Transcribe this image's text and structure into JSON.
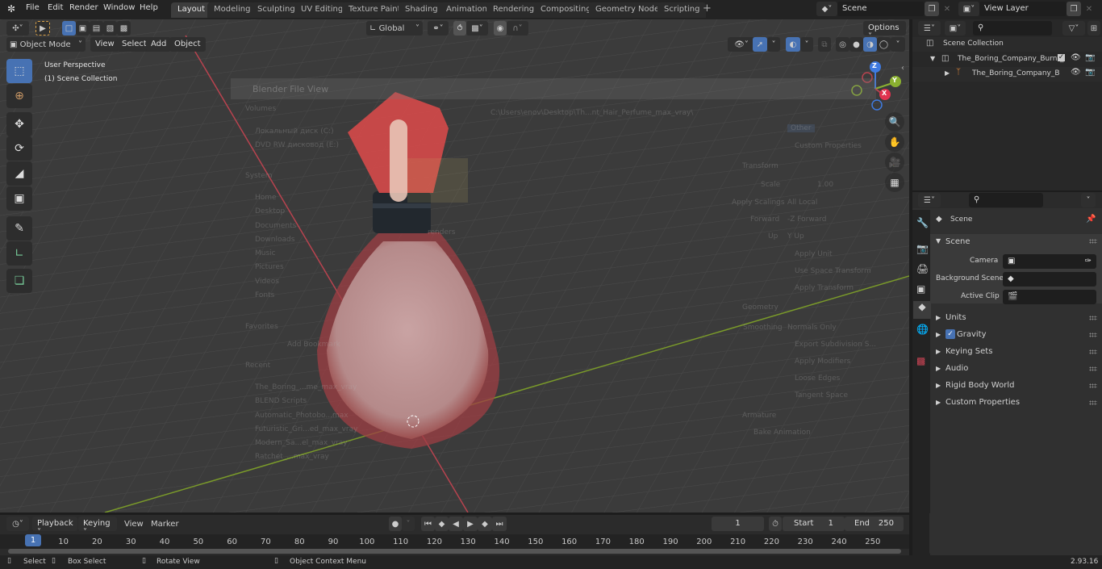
{
  "topbar": {
    "menu": [
      "File",
      "Edit",
      "Render",
      "Window",
      "Help"
    ],
    "workspaces": [
      "Layout",
      "Modeling",
      "Sculpting",
      "UV Editing",
      "Texture Paint",
      "Shading",
      "Animation",
      "Rendering",
      "Compositing",
      "Geometry Nodes",
      "Scripting"
    ],
    "active_workspace": "Layout",
    "add_workspace": "+",
    "scene": "Scene",
    "view_layer": "View Layer"
  },
  "viewport": {
    "mode": "Object Mode",
    "menus": [
      "View",
      "Select",
      "Add",
      "Object"
    ],
    "transform_orientation": "Global",
    "options": "Options",
    "overlay_title": "User Perspective",
    "overlay_collection": "(1) Scene Collection",
    "gizmo": {
      "z": "Z",
      "y": "Y",
      "x": "X"
    },
    "tools": [
      "select-box",
      "cursor",
      "move",
      "rotate",
      "scale",
      "transform",
      "annotate",
      "measure",
      "add-cube"
    ]
  },
  "file_view_ghost": {
    "title": "Blender File View",
    "path": "C:\\Users\\enov\\Desktop\\Th...nt_Hair_Perfume_max_vray\\",
    "volumes_header": "Volumes",
    "volumes": [
      "Локальный диск (C:)",
      "DVD RW дисковод (E:)"
    ],
    "system_header": "System",
    "system": [
      "Home",
      "Desktop",
      "Documents",
      "Downloads",
      "Music",
      "Pictures",
      "Videos",
      "Fonts"
    ],
    "favorites_header": "Favorites",
    "add_bookmark": "Add Bookmark",
    "recent_header": "Recent",
    "recent": [
      "The_Boring_...me_max_vray",
      "BLEND Scripts",
      "Automatic_Photobo...max",
      "Futuristic_Gri...ed_max_vray",
      "Modern_Sa...el_max_vray",
      "Ratchet_...max_vray"
    ],
    "folder_label": "renders",
    "options": {
      "other": "Other",
      "custom_properties": "Custom Properties",
      "transform_header": "Transform",
      "scale_label": "Scale",
      "scale": "1.00",
      "apply_scalings_label": "Apply Scalings",
      "apply_scalings": "All Local",
      "forward_label": "Forward",
      "forward": "-Z Forward",
      "up_label": "Up",
      "up": "Y Up",
      "apply_unit": "Apply Unit",
      "use_space_transform": "Use Space Transform",
      "apply_transform": "Apply Transform",
      "geometry_header": "Geometry",
      "smoothing_label": "Smoothing",
      "smoothing": "Normals Only",
      "export_subdivision": "Export Subdivision S...",
      "apply_modifiers": "Apply Modifiers",
      "loose_edges": "Loose Edges",
      "tangent_space": "Tangent Space",
      "armature_header": "Armature",
      "bake_animation": "Bake Animation"
    }
  },
  "outliner": {
    "root": "Scene Collection",
    "items": [
      {
        "label": "The_Boring_Company_Burnt_",
        "type": "collection"
      },
      {
        "label": "The_Boring_Company_B",
        "type": "empty"
      }
    ]
  },
  "properties": {
    "context": "Scene",
    "panel": "Scene",
    "camera_label": "Camera",
    "background_scene_label": "Background Scene",
    "active_clip_label": "Active Clip",
    "sections": [
      "Units",
      "Gravity",
      "Keying Sets",
      "Audio",
      "Rigid Body World",
      "Custom Properties"
    ],
    "gravity_checked": true
  },
  "timeline": {
    "menus": [
      "Playback",
      "Keying",
      "View",
      "Marker"
    ],
    "current_frame": "1",
    "start_label": "Start",
    "start": "1",
    "end_label": "End",
    "end": "250",
    "ticks": [
      "10",
      "20",
      "30",
      "40",
      "50",
      "60",
      "70",
      "80",
      "90",
      "100",
      "110",
      "120",
      "130",
      "140",
      "150",
      "160",
      "170",
      "180",
      "190",
      "200",
      "210",
      "220",
      "230",
      "240",
      "250"
    ],
    "playhead": "1"
  },
  "statusbar": {
    "select": "Select",
    "box_select": "Box Select",
    "rotate_view": "Rotate View",
    "context_menu": "Object Context Menu",
    "version": "2.93.16"
  }
}
